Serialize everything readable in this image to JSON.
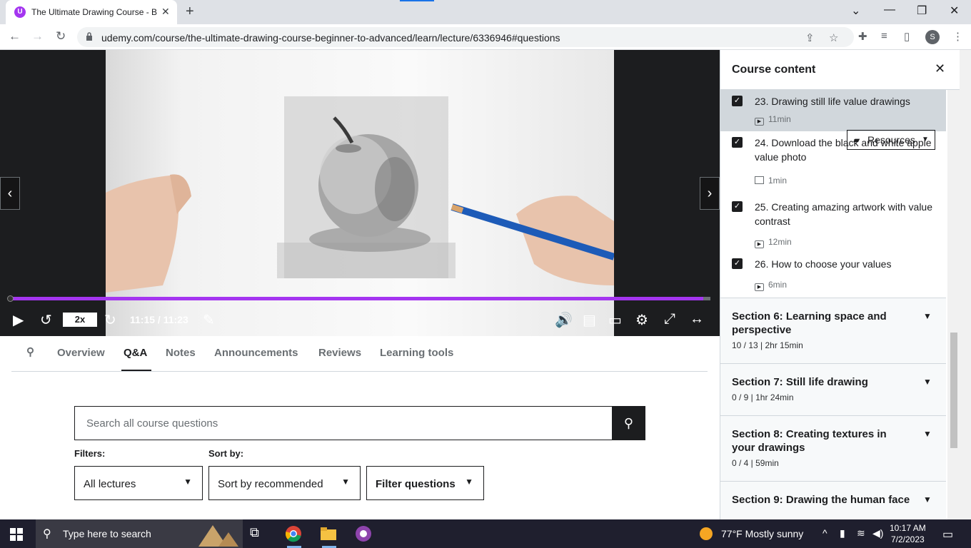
{
  "browser": {
    "tab_title": "The Ultimate Drawing Course - B",
    "tab_favicon_letter": "U",
    "url": "udemy.com/course/the-ultimate-drawing-course-beginner-to-advanced/learn/lecture/6336946#questions",
    "profile_initial": "S",
    "accent_color": "#a435f0"
  },
  "video": {
    "speed": "2x",
    "time": "11:15 / 11:23",
    "progress_fraction": 0.99
  },
  "tabs": [
    {
      "label": "Overview"
    },
    {
      "label": "Q&A"
    },
    {
      "label": "Notes"
    },
    {
      "label": "Announcements"
    },
    {
      "label": "Reviews"
    },
    {
      "label": "Learning tools"
    }
  ],
  "qa": {
    "search_placeholder": "Search all course questions",
    "filters_label": "Filters:",
    "sort_label": "Sort by:",
    "filter_value": "All lectures",
    "sort_value": "Sort by recommended",
    "filter_questions": "Filter questions"
  },
  "sidebar": {
    "title": "Course content",
    "lectures": [
      {
        "title": "23. Drawing still life value drawings",
        "meta": "11min",
        "icon": "play-icon"
      },
      {
        "title": "24. Download the black and white apple value photo",
        "meta": "1min",
        "icon": "file-icon"
      },
      {
        "title": "25. Creating amazing artwork with value contrast",
        "meta": "12min",
        "icon": "play-icon"
      },
      {
        "title": "26. How to choose your values",
        "meta": "6min",
        "icon": "play-icon"
      }
    ],
    "resources_label": "Resources",
    "sections": [
      {
        "title": "Section 6: Learning space and perspective",
        "meta": "10 / 13 | 2hr 15min"
      },
      {
        "title": "Section 7: Still life drawing",
        "meta": "0 / 9 | 1hr 24min"
      },
      {
        "title": "Section 8: Creating textures in your drawings",
        "meta": "0 / 4 | 59min"
      },
      {
        "title": "Section 9: Drawing the human face",
        "meta": ""
      }
    ]
  },
  "taskbar": {
    "search_placeholder": "Type here to search",
    "weather": "77°F  Mostly sunny",
    "time": "10:17 AM",
    "date": "7/2/2023"
  }
}
